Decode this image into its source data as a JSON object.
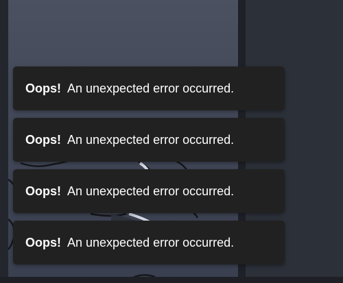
{
  "notifications": [
    {
      "title": "Oops!",
      "message": "An unexpected error occurred."
    },
    {
      "title": "Oops!",
      "message": "An unexpected error occurred."
    },
    {
      "title": "Oops!",
      "message": "An unexpected error occurred."
    },
    {
      "title": "Oops!",
      "message": "An unexpected error occurred."
    }
  ],
  "colors": {
    "toast_background": "#212121",
    "toast_text": "#ffffff",
    "content_background": "#474d5d",
    "sidebar_background": "#2c3039"
  }
}
